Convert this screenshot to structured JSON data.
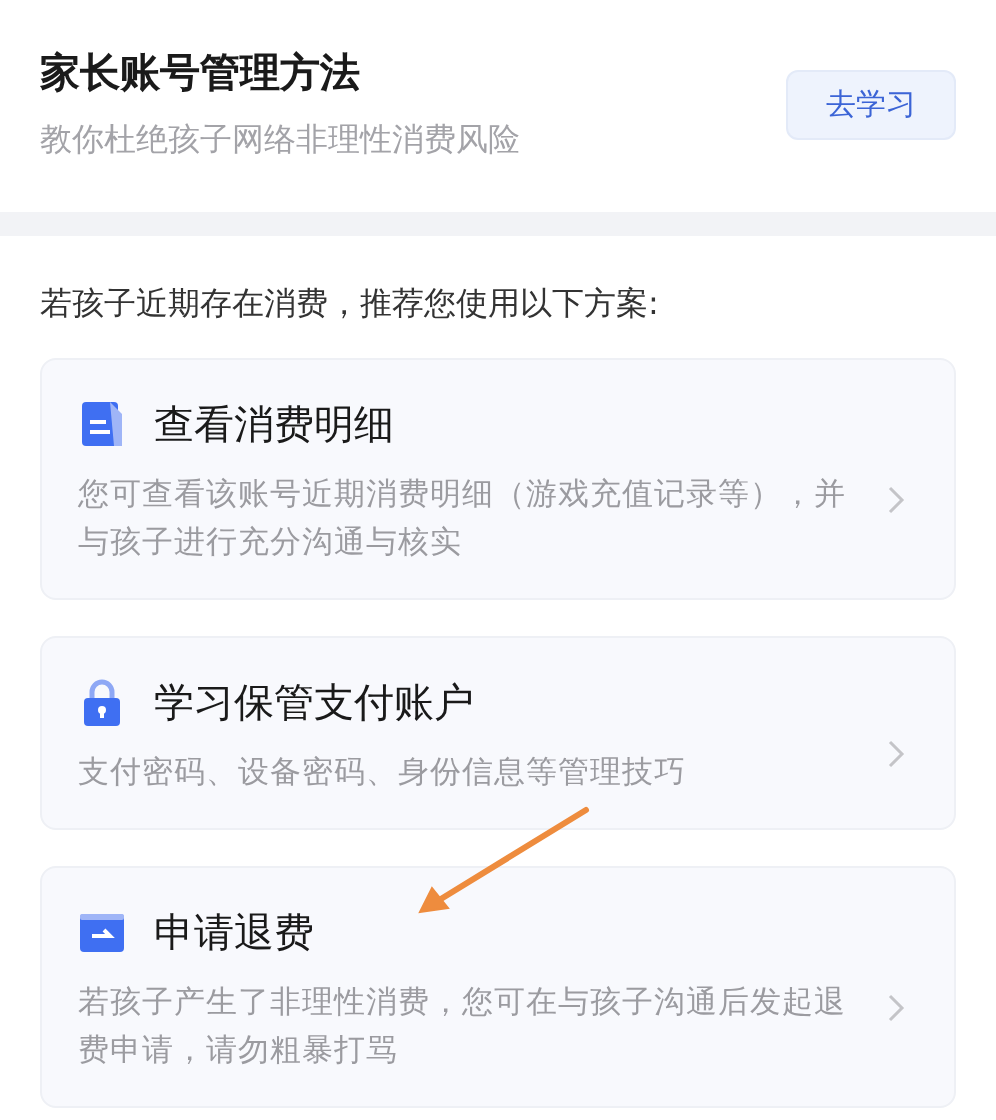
{
  "header": {
    "title": "家长账号管理方法",
    "subtitle": "教你杜绝孩子网络非理性消费风险",
    "button": "去学习"
  },
  "intro": "若孩子近期存在消费，推荐您使用以下方案:",
  "options": [
    {
      "kind": "document",
      "title": "查看消费明细",
      "description": "您可查看该账号近期消费明细（游戏充值记录等），并与孩子进行充分沟通与核实"
    },
    {
      "kind": "lock",
      "title": "学习保管支付账户",
      "description": "支付密码、设备密码、身份信息等管理技巧"
    },
    {
      "kind": "wallet",
      "title": "申请退费",
      "description": "若孩子产生了非理性消费，您可在与孩子沟通后发起退费申请，请勿粗暴打骂"
    }
  ]
}
